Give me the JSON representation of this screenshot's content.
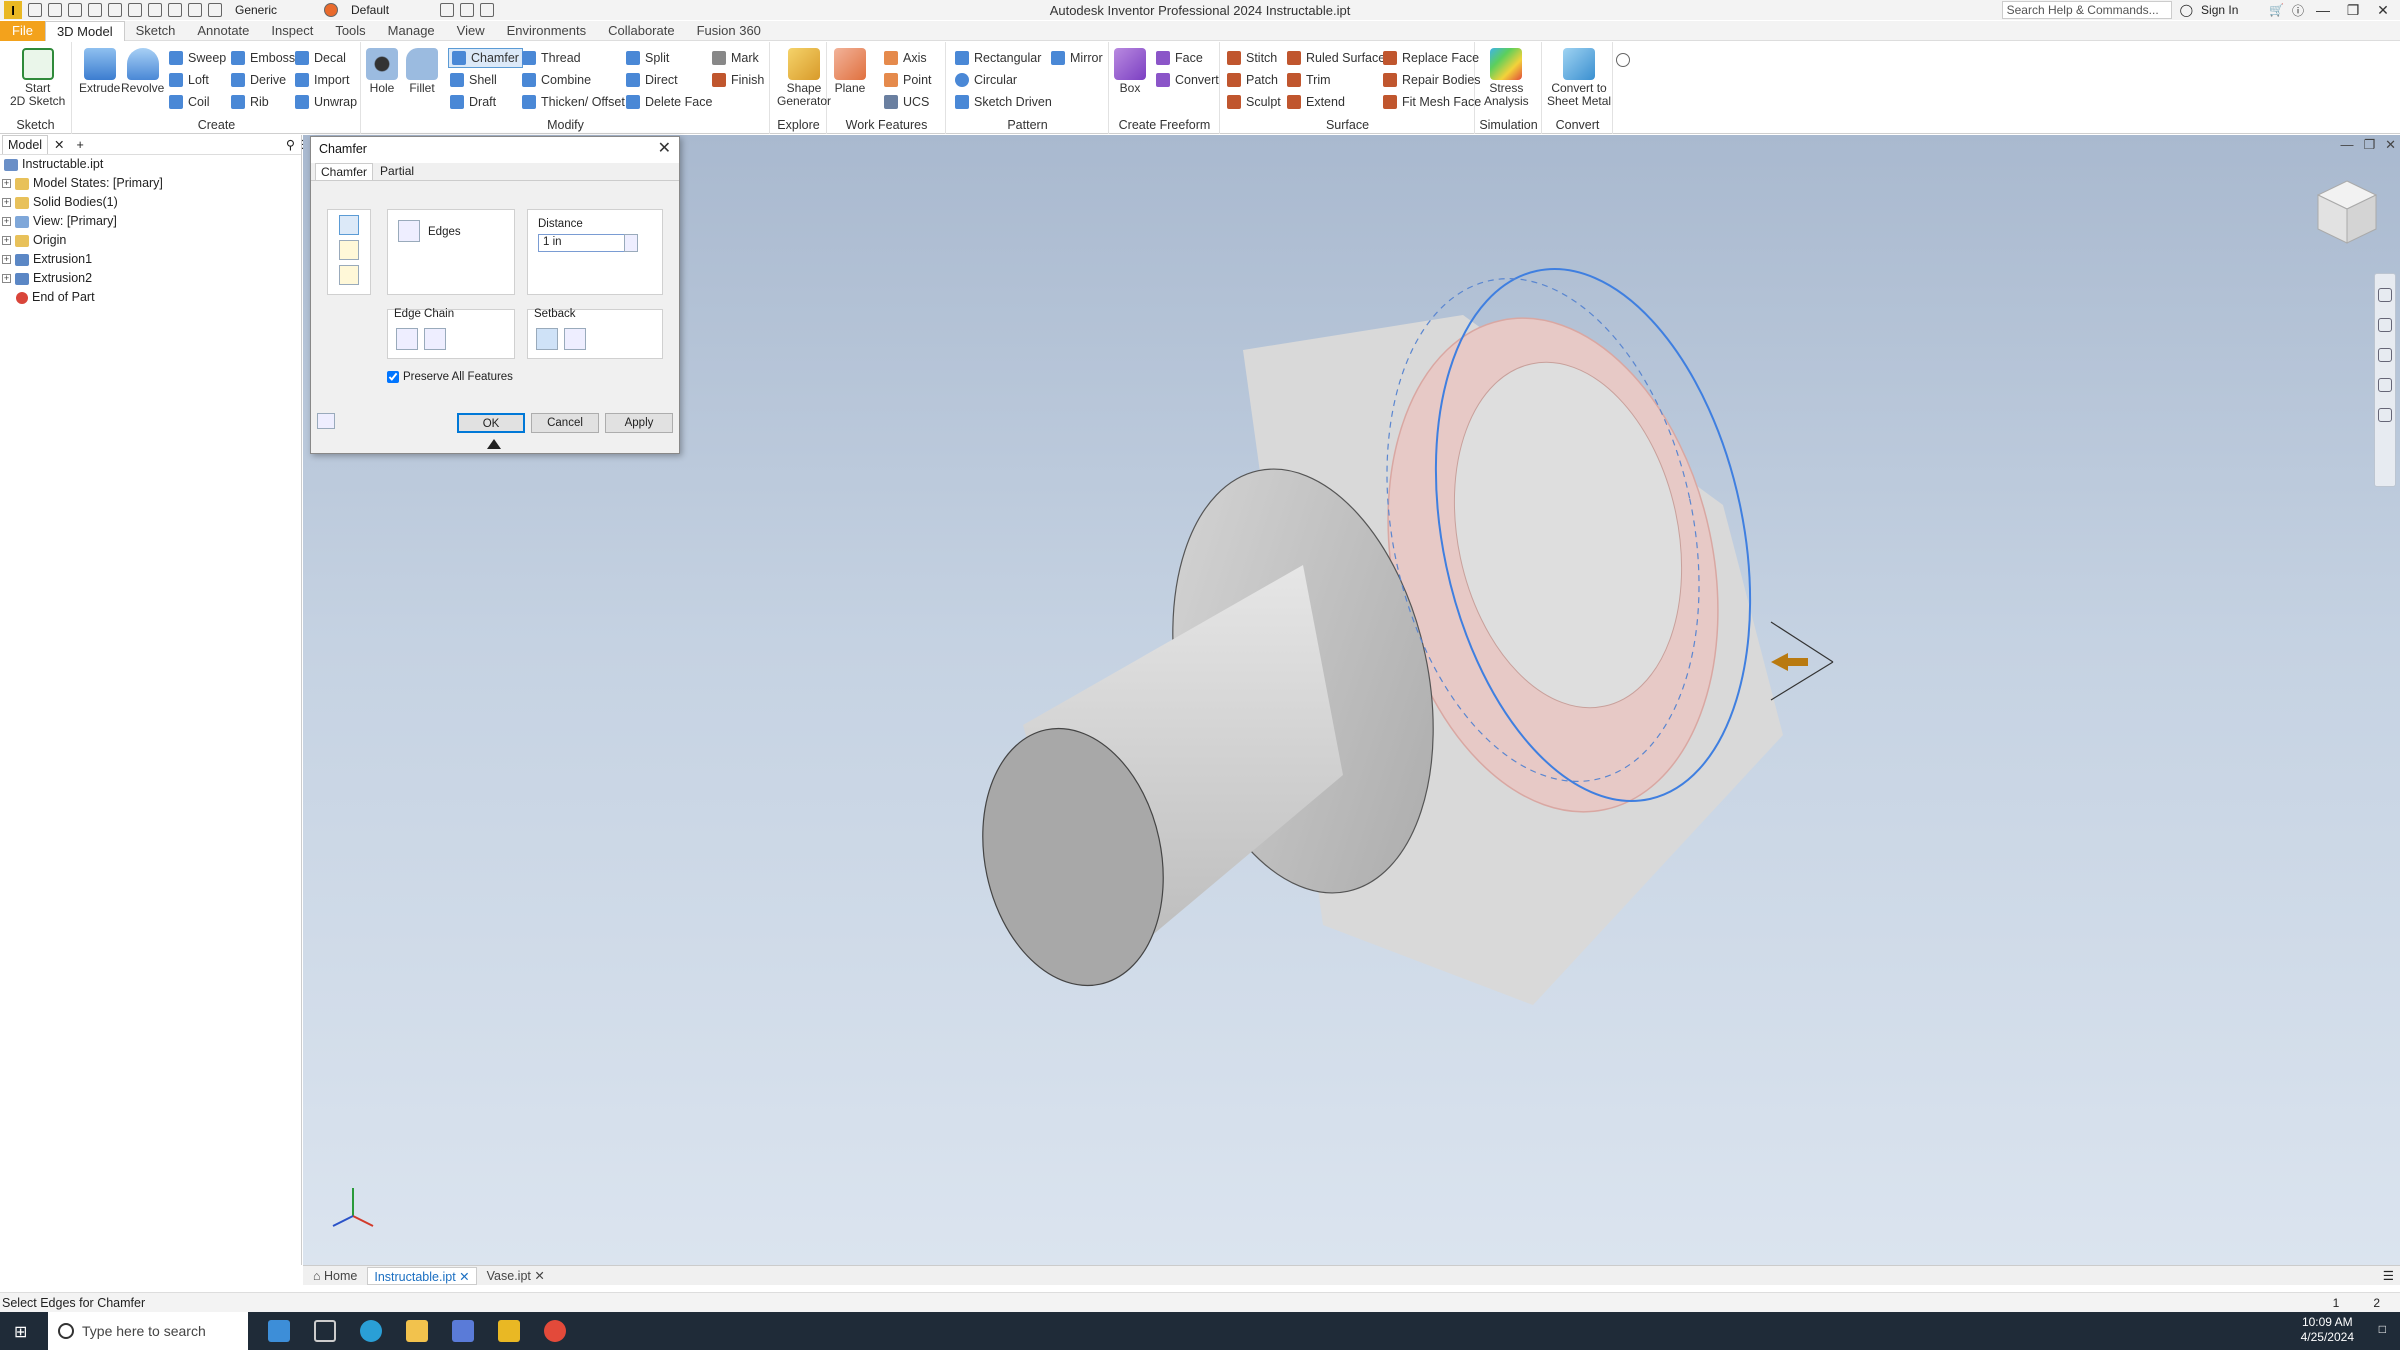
{
  "app": {
    "title": "Autodesk Inventor Professional 2024   Instructable.ipt",
    "appearance": "Generic",
    "view_style": "Default",
    "search_placeholder": "Search Help & Commands...",
    "sign_in": "Sign In"
  },
  "menu_tabs": [
    "File",
    "3D Model",
    "Sketch",
    "Annotate",
    "Inspect",
    "Tools",
    "Manage",
    "View",
    "Environments",
    "Collaborate",
    "Fusion 360"
  ],
  "ribbon": {
    "sketch": {
      "title": "Sketch",
      "start": "Start",
      "start2": "2D Sketch"
    },
    "create": {
      "title": "Create",
      "extrude": "Extrude",
      "revolve": "Revolve",
      "sweep": "Sweep",
      "loft": "Loft",
      "coil": "Coil",
      "emboss": "Emboss",
      "derive": "Derive",
      "rib": "Rib",
      "decal": "Decal",
      "import": "Import",
      "unwrap": "Unwrap"
    },
    "modify": {
      "title": "Modify",
      "hole": "Hole",
      "fillet": "Fillet",
      "chamfer": "Chamfer",
      "shell": "Shell",
      "draft": "Draft",
      "thread": "Thread",
      "combine": "Combine",
      "thicken": "Thicken/ Offset",
      "split": "Split",
      "direct": "Direct",
      "delete_face": "Delete Face",
      "mark": "Mark",
      "finish": "Finish"
    },
    "explore": {
      "title": "Explore",
      "shape_gen": "Shape",
      "shape_gen2": "Generator"
    },
    "work": {
      "title": "Work Features",
      "plane": "Plane",
      "axis": "Axis",
      "point": "Point",
      "ucs": "UCS"
    },
    "pattern": {
      "title": "Pattern",
      "rectangular": "Rectangular",
      "circular": "Circular",
      "sketch_driven": "Sketch Driven",
      "mirror": "Mirror"
    },
    "freeform": {
      "title": "Create Freeform",
      "box": "Box",
      "face": "Face",
      "convert": "Convert"
    },
    "surface": {
      "title": "Surface",
      "stitch": "Stitch",
      "patch": "Patch",
      "sculpt": "Sculpt",
      "ruled": "Ruled Surface",
      "trim": "Trim",
      "extend": "Extend",
      "replace": "Replace Face",
      "repair": "Repair Bodies",
      "fitmesh": "Fit Mesh Face"
    },
    "simulation": {
      "title": "Simulation",
      "stress": "Stress",
      "stress2": "Analysis"
    },
    "convert": {
      "title": "Convert",
      "sheet": "Convert to",
      "sheet2": "Sheet Metal"
    }
  },
  "browser": {
    "tab": "Model",
    "nodes": [
      {
        "label": "Instructable.ipt",
        "color": "#6a8fc7"
      },
      {
        "label": "Model States: [Primary]",
        "color": "#e8c15a"
      },
      {
        "label": "Solid Bodies(1)",
        "color": "#e8c15a"
      },
      {
        "label": "View: [Primary]",
        "color": "#7fa7d9"
      },
      {
        "label": "Origin",
        "color": "#e8c15a"
      },
      {
        "label": "Extrusion1",
        "color": "#5b87c5"
      },
      {
        "label": "Extrusion2",
        "color": "#5b87c5"
      },
      {
        "label": "End of Part",
        "color": "#d9453a"
      }
    ]
  },
  "dialog": {
    "title": "Chamfer",
    "tabs": [
      "Chamfer",
      "Partial"
    ],
    "edges_label": "Edges",
    "distance_label": "Distance",
    "distance_value": "1 in",
    "edge_chain_label": "Edge Chain",
    "setback_label": "Setback",
    "preserve_label": "Preserve All Features",
    "preserve_checked": true,
    "ok": "OK",
    "cancel": "Cancel",
    "apply": "Apply"
  },
  "doc_tabs": {
    "home": "Home",
    "active": "Instructable.ipt",
    "other": "Vase.ipt"
  },
  "status": {
    "text": "Select Edges for Chamfer",
    "n1": "1",
    "n2": "2"
  },
  "taskbar": {
    "search": "Type here to search",
    "time": "10:09 AM",
    "date": "4/25/2024"
  },
  "colors": {
    "file_tab": "#f3a21c",
    "selection_edge": "#3f7fe0",
    "chamfer_preview": "#e7b9b5"
  }
}
